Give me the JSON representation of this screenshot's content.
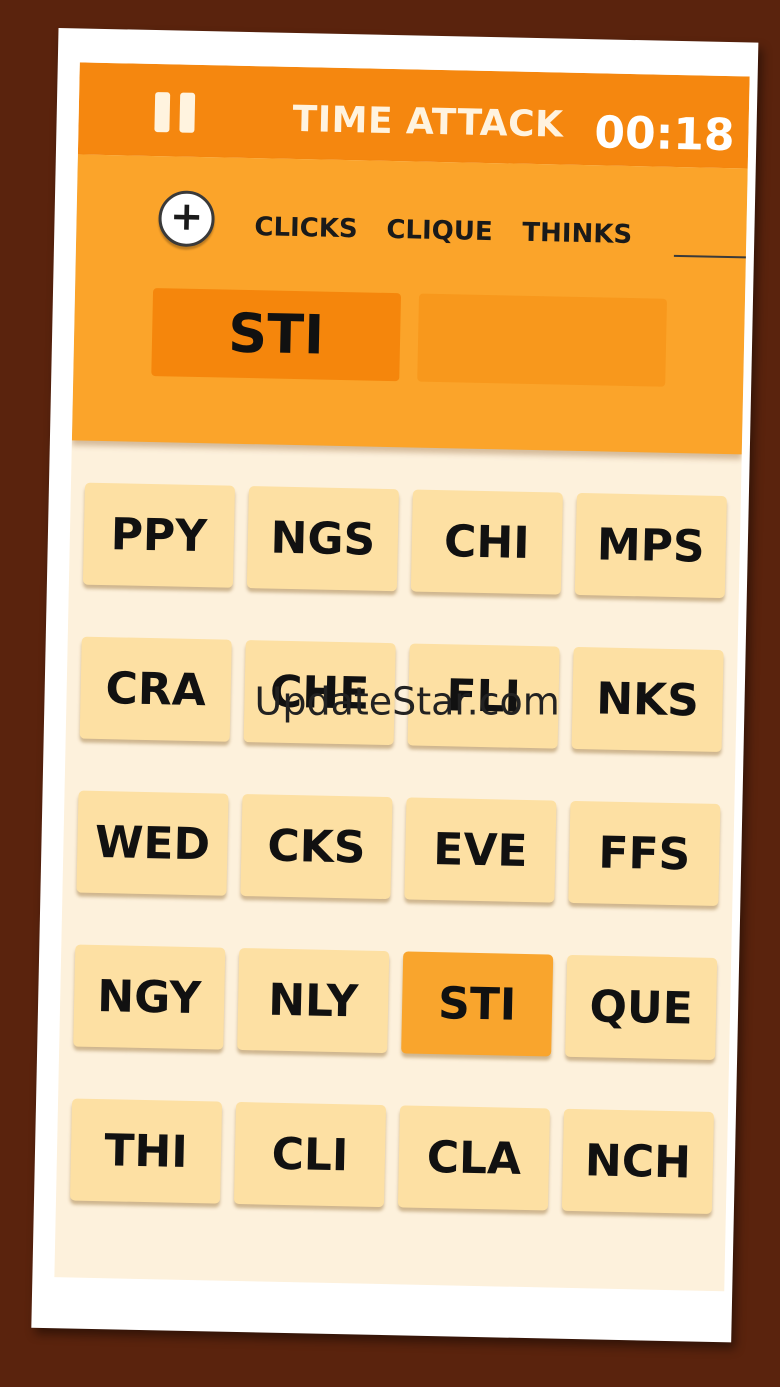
{
  "header": {
    "pause_icon": "pause-icon",
    "mode": "TIME ATTACK",
    "timer": "00:18"
  },
  "words_panel": {
    "add_icon": "plus-icon",
    "found_words": [
      "CLICKS",
      "CLIQUE",
      "THINKS"
    ],
    "current_slots": [
      "STI",
      ""
    ]
  },
  "tiles": [
    "PPY",
    "NGS",
    "CHI",
    "MPS",
    "CRA",
    "CHE",
    "FLI",
    "NKS",
    "WED",
    "CKS",
    "EVE",
    "FFS",
    "NGY",
    "NLY",
    "STI",
    "QUE",
    "THI",
    "CLI",
    "CLA",
    "NCH"
  ],
  "selected_tile_index": 14,
  "watermark": "UpdateStar.com",
  "colors": {
    "header": "#f5870f",
    "panel": "#fba42a",
    "tile": "#fde0a3",
    "tile_selected": "#f9a52d",
    "background": "#5a230d"
  }
}
